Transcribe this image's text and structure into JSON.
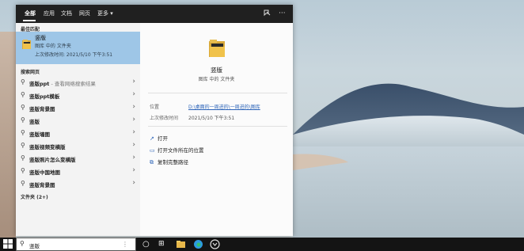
{
  "tabs": {
    "all": "全部",
    "apps": "应用",
    "docs": "文档",
    "web": "网页",
    "more": "更多",
    "more_caret": "▾",
    "feedback_icon": "feedback-icon",
    "options_icon": "···"
  },
  "best_match": {
    "title": "最佳匹配",
    "name": "竖版",
    "subtitle": "图库 中的 文件夹",
    "date": "上次修改时间: 2021/5/10 下午3:51"
  },
  "search_web": {
    "title": "搜索网页",
    "items": [
      {
        "bold": "竖版ppt",
        "hint": " - 查看网络搜索结果"
      },
      {
        "bold": "竖版ppt模板",
        "hint": ""
      },
      {
        "bold": "竖版背景图",
        "hint": ""
      },
      {
        "bold": "竖版",
        "hint": ""
      },
      {
        "bold": "竖版墙图",
        "hint": ""
      },
      {
        "bold": "竖版视频变横版",
        "hint": ""
      },
      {
        "bold": "竖版照片怎么变横版",
        "hint": ""
      },
      {
        "bold": "竖版中国地图",
        "hint": ""
      },
      {
        "bold": "竖版背景图",
        "hint": ""
      }
    ],
    "chevron": "›"
  },
  "folders": {
    "title": "文件夹 (2+)"
  },
  "detail": {
    "name": "竖版",
    "subtitle": "图库 中的 文件夹",
    "location_label": "位置",
    "location_value": "D:\\桌面的一周进的\\一周进的\\图库",
    "modified_label": "上次修改时间",
    "modified_value": "2021/5/10 下午3:51",
    "actions": [
      {
        "icon": "open-icon",
        "glyph": "↗",
        "label": "打开"
      },
      {
        "icon": "folder-location-icon",
        "glyph": "▭",
        "label": "打开文件所在的位置"
      },
      {
        "icon": "copy-path-icon",
        "glyph": "⧉",
        "label": "复制完整路径"
      }
    ]
  },
  "taskbar": {
    "search_value": "竖版",
    "caret": "⋮",
    "cortana_glyph": "○",
    "taskview_glyph": "⊞"
  },
  "colors": {
    "accent": "#9ec6e7",
    "taskbar": "#141414",
    "tabbar": "#202020"
  }
}
